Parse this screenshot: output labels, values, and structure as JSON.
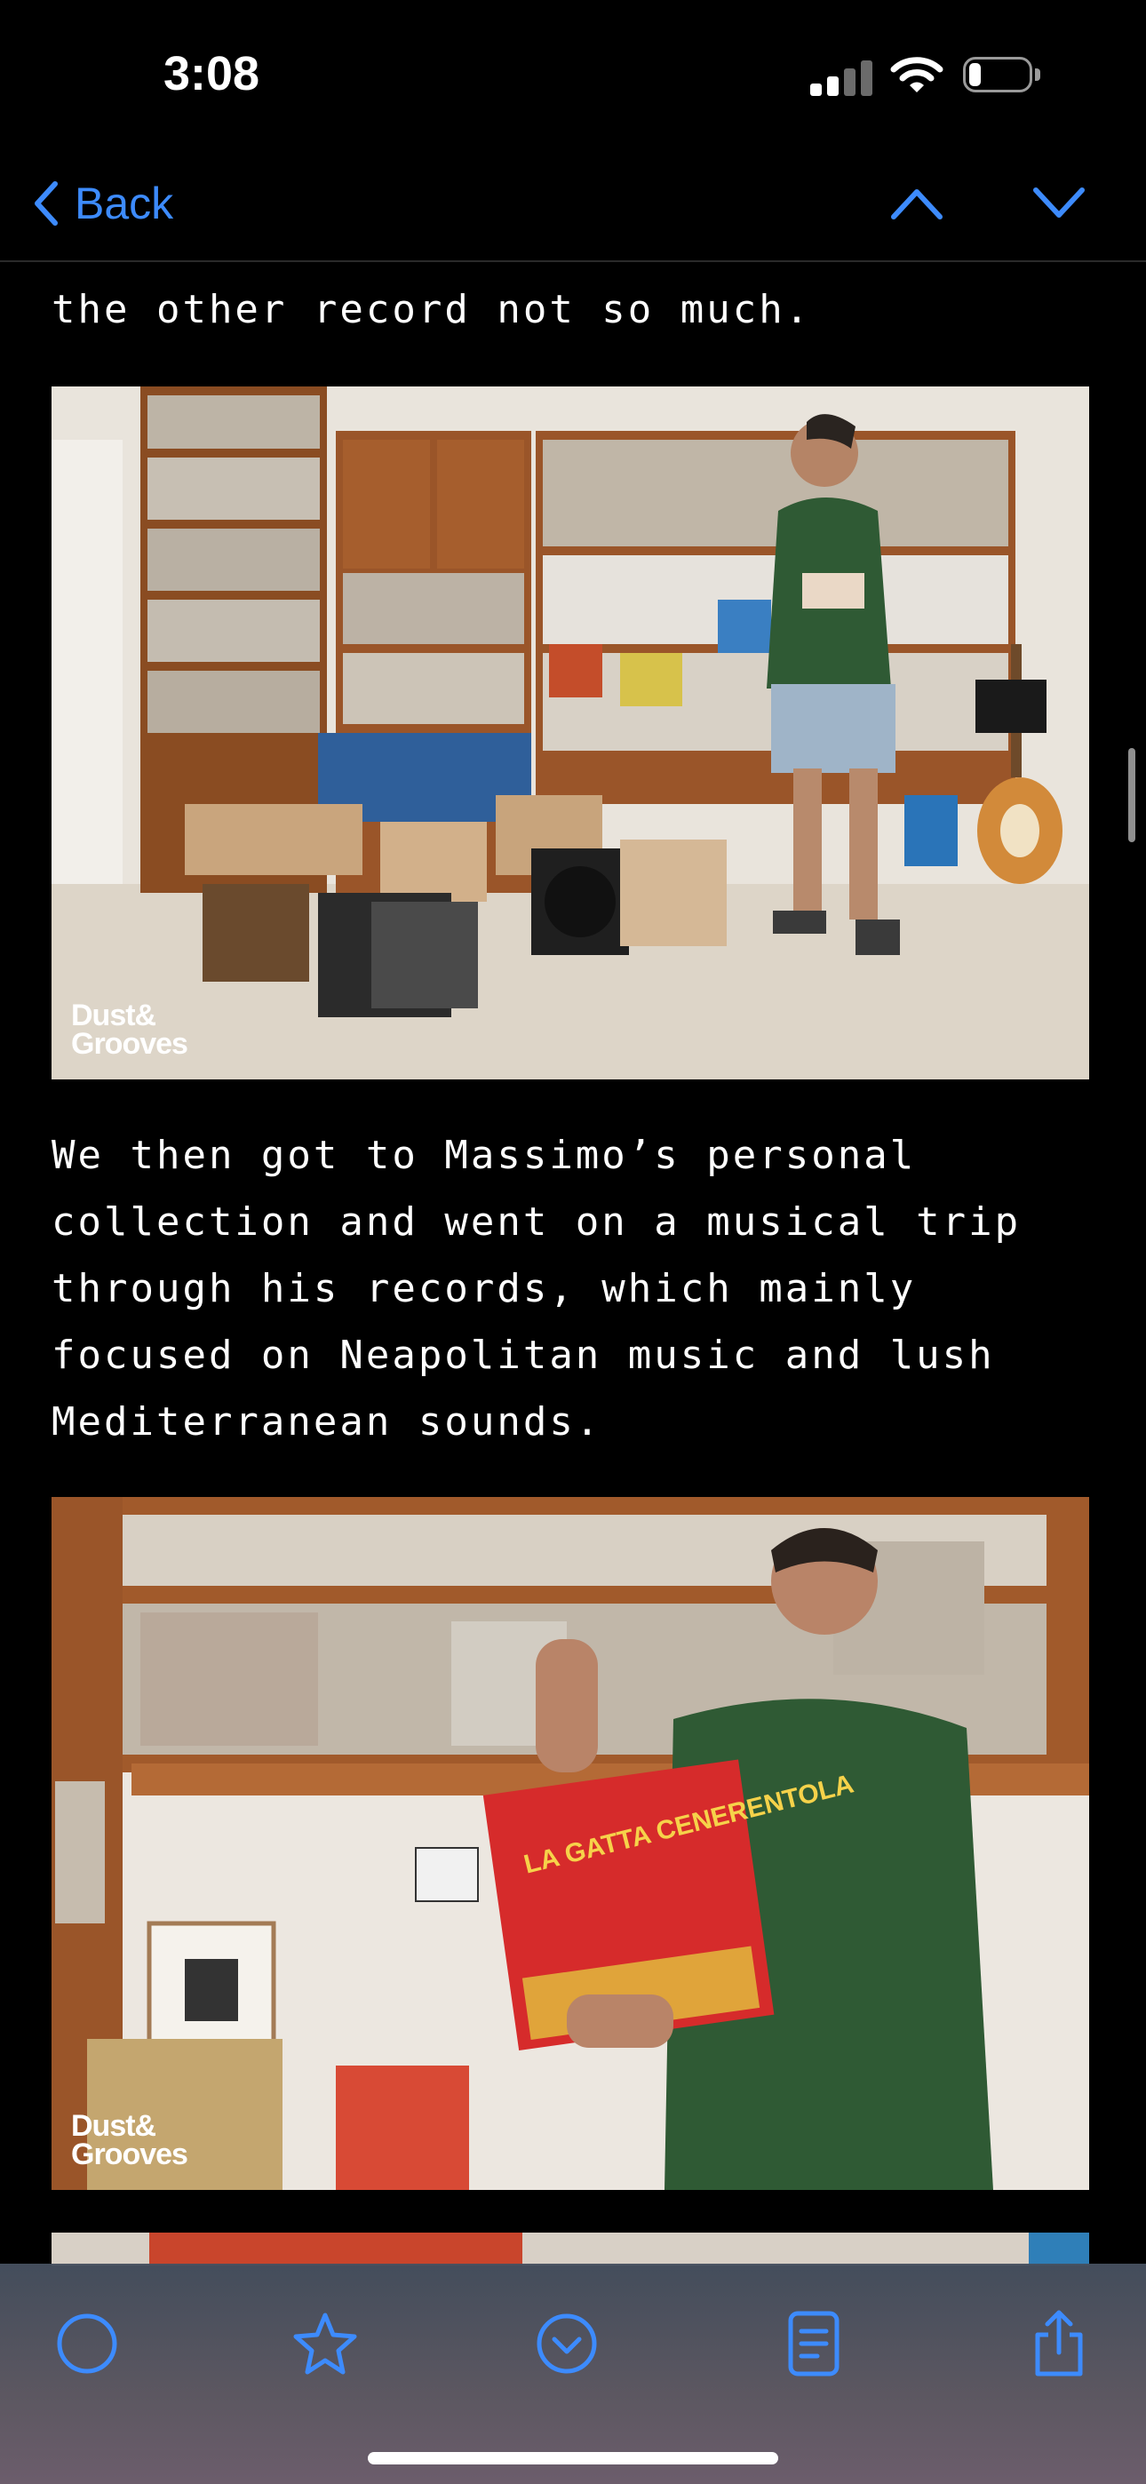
{
  "status_bar": {
    "time": "3:08",
    "battery_level": 0.2
  },
  "nav": {
    "back_label": "Back"
  },
  "article": {
    "partial_line": "the other record not so much.",
    "paragraph": "We then got to Massimo’s personal\ncollection and went on a musical trip\nthrough his records, which mainly\nfocused on Neapolitan music and lush\nMediterranean sounds.",
    "photos": [
      {
        "watermark_line1": "Dust&",
        "watermark_line2": "Grooves"
      },
      {
        "watermark_line1": "Dust&",
        "watermark_line2": "Grooves",
        "record_title": "LA GATTA CENERENTOLA"
      }
    ]
  },
  "toolbar": {
    "icons": [
      "circle-icon",
      "star-icon",
      "checkmark-circle-icon",
      "reader-icon",
      "share-icon"
    ]
  },
  "colors": {
    "accent": "#3d8bfd",
    "background": "#000000"
  }
}
